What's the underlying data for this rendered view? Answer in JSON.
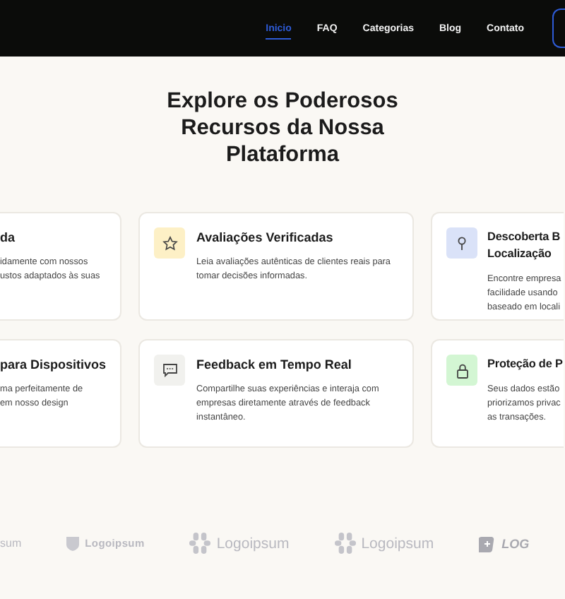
{
  "nav": {
    "links": [
      {
        "label": "Inicio",
        "selected": true
      },
      {
        "label": "FAQ",
        "selected": false
      },
      {
        "label": "Categorias",
        "selected": false
      },
      {
        "label": "Blog",
        "selected": false
      },
      {
        "label": "Contato",
        "selected": false
      }
    ]
  },
  "heading": "Explore os Poderosos Recursos da Nossa Plataforma",
  "cards": [
    {
      "kind": "cut-left",
      "title_lines": [
        "da"
      ],
      "description_lines": [
        "idamente com nossos",
        "ustos adaptados às suas"
      ]
    },
    {
      "kind": "star",
      "color": "#fdf0c6",
      "title_lines": [
        "Avaliações Verificadas"
      ],
      "description_lines": [
        "Leia avaliações autênticas de clientes reais para tomar decisões informadas."
      ]
    },
    {
      "kind": "pin",
      "color": "#dae2f8",
      "title_lines": [
        "Descoberta B",
        "Localização"
      ],
      "description_lines": [
        "Encontre empresa",
        "facilidade usando",
        "baseado em locali"
      ]
    },
    {
      "kind": "cut-left",
      "title_lines": [
        "para Dispositivos"
      ],
      "description_lines": [
        "ma perfeitamente de",
        "em nosso design"
      ]
    },
    {
      "kind": "chat",
      "color": "#f1f1ee",
      "title_lines": [
        "Feedback em Tempo Real"
      ],
      "description_lines": [
        "Compartilhe suas experiências e interaja com empresas diretamente através de feedback instantâneo."
      ]
    },
    {
      "kind": "lock",
      "color": "#d3f6d3",
      "title_lines": [
        "Proteção de P"
      ],
      "description_lines": [
        "Seus dados estão",
        "priorizamos privac",
        "as transações."
      ]
    }
  ],
  "logos": [
    {
      "kind": "plain",
      "text": "sum"
    },
    {
      "kind": "shield",
      "text": "Logoipsum"
    },
    {
      "kind": "flower",
      "text": "Logoipsum"
    },
    {
      "kind": "flower",
      "text": "Logoipsum"
    },
    {
      "kind": "box",
      "text": "LOG"
    }
  ]
}
